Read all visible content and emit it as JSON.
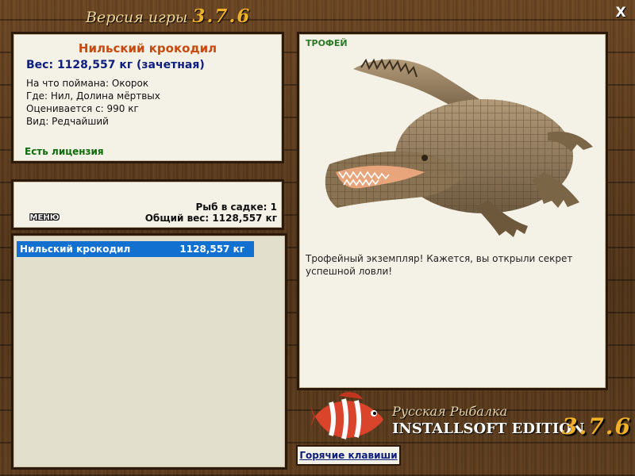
{
  "header": {
    "title_text": "Версия игры",
    "title_version": "3.7.6",
    "close_label": "X"
  },
  "info": {
    "fish_name": "Нильский крокодил",
    "weight": "Вес: 1128,557 кг (зачетная)",
    "bait": "На что поймана: Окорок",
    "location": "Где: Нил, Долина мёртвых",
    "rated_from": "Оценивается с: 990 кг",
    "kind": "Вид: Редчайший",
    "license": "Есть лицензия"
  },
  "stats": {
    "menu_label": "МЕНЮ",
    "fish_count": "Рыб в садке: 1",
    "total_weight": "Общий вес: 1128,557 кг"
  },
  "list": {
    "items": [
      {
        "name": "Нильский крокодил",
        "weight": "1128,557 кг"
      }
    ]
  },
  "trophy": {
    "badge": "ТРОФЕЙ",
    "description": "Трофейный экземпляр! Кажется, вы открыли секрет успешной ловли!"
  },
  "brand": {
    "title": "Русская Рыбалка",
    "edition": "INSTALLSOFT EDITION",
    "version": "3.7.6"
  },
  "hotkeys_label": "Горячие клавиши",
  "colors": {
    "accent_orange": "#c84a0e",
    "weight_blue": "#0d1e7e",
    "license_green": "#0f6a0c",
    "selection_blue": "#1170d0",
    "version_gold": "#f0b028"
  }
}
